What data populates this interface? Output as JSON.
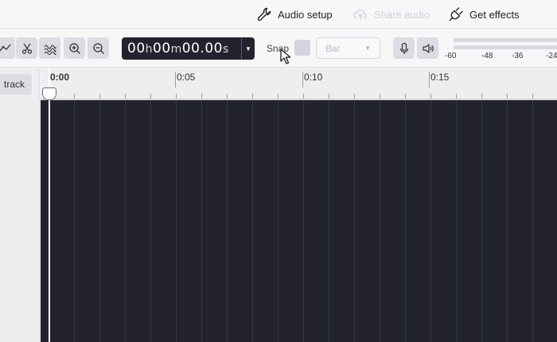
{
  "header": {
    "audio_setup": "Audio setup",
    "share_audio": "Share audio",
    "get_effects": "Get effects"
  },
  "toolbar": {
    "icons": [
      "envelope-tool-icon",
      "multi-cut-icon",
      "waveform-tool-icon",
      "zoom-in-icon",
      "zoom-out-icon"
    ],
    "timecode": {
      "hh": "00",
      "h": "h",
      "mm": "00",
      "m": "m",
      "ss": "00.00",
      "s": "s"
    },
    "snap_label": "Snap",
    "snap_enabled": false,
    "snap_unit": "Bar",
    "record_meter_icon": "microphone-icon",
    "playback_meter_icon": "speaker-icon"
  },
  "meter": {
    "scale": [
      "-60",
      "-48",
      "-36",
      "-24"
    ]
  },
  "sidebar": {
    "add_track_label": "track"
  },
  "timeline": {
    "ruler_labels": [
      "0:00",
      "0:05",
      "0:10",
      "0:15"
    ]
  },
  "colors": {
    "track_area": "#22232e",
    "timecode_bg": "#22232e",
    "button_bg": "#dcdce3"
  }
}
